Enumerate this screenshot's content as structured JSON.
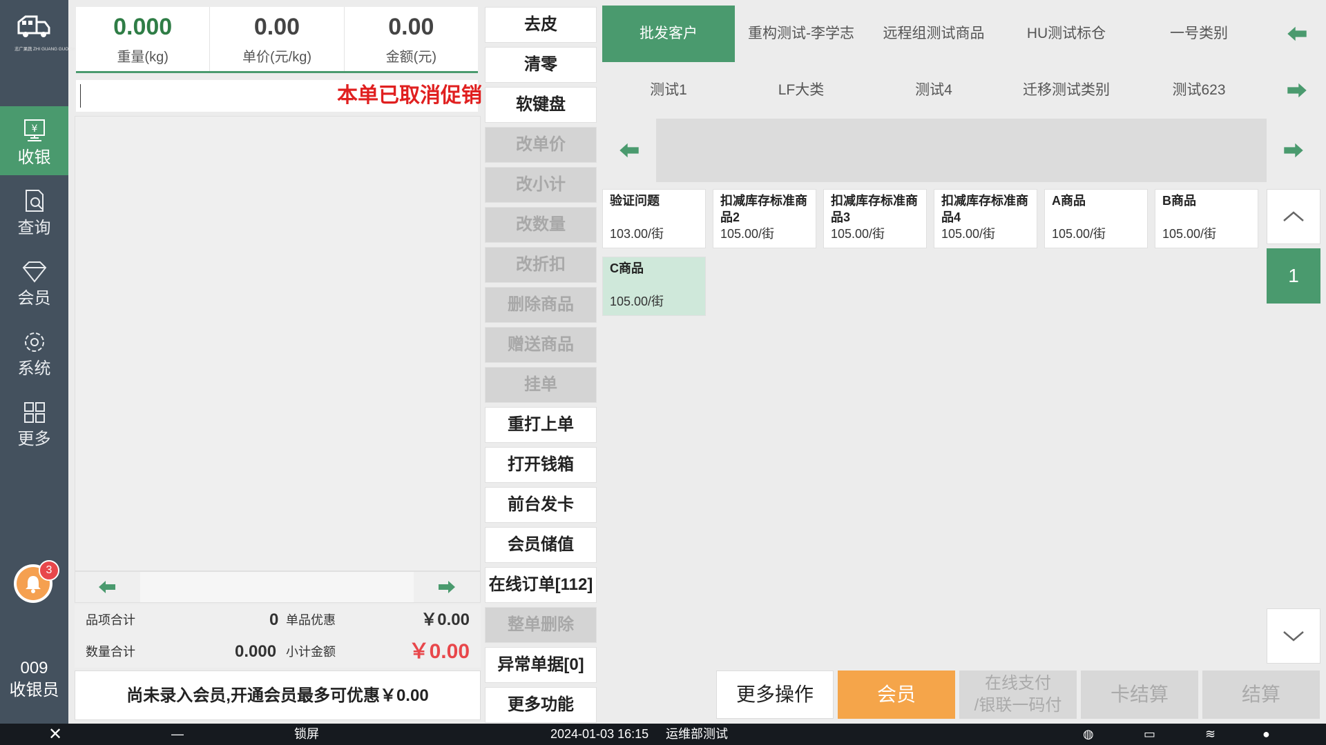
{
  "sidebar": {
    "logo_text": "志广果蔬 ZHI GUANG GUO SHU",
    "items": [
      {
        "label": "收银",
        "icon": "cashier-icon"
      },
      {
        "label": "查询",
        "icon": "search-doc-icon"
      },
      {
        "label": "会员",
        "icon": "diamond-icon"
      },
      {
        "label": "系统",
        "icon": "gear-icon"
      },
      {
        "label": "更多",
        "icon": "grid-icon"
      }
    ],
    "notification_count": "3",
    "cashier_no": "009",
    "cashier_label": "收银员"
  },
  "scale": {
    "weight": "0.000",
    "weight_label": "重量(kg)",
    "unit_price": "0.00",
    "unit_price_label": "单价(元/kg)",
    "amount": "0.00",
    "amount_label": "金额(元)"
  },
  "promo_notice": "本单已取消促销",
  "totals": {
    "items_label": "品项合计",
    "items_value": "0",
    "discount_label": "单品优惠",
    "discount_value": "￥0.00",
    "qty_label": "数量合计",
    "qty_value": "0.000",
    "subtotal_label": "小计金额",
    "subtotal_value": "￥0.00"
  },
  "member_notice": "尚未录入会员,开通会员最多可优惠￥0.00",
  "functions": [
    {
      "label": "去皮",
      "enabled": true
    },
    {
      "label": "清零",
      "enabled": true
    },
    {
      "label": "软键盘",
      "enabled": true
    },
    {
      "label": "改单价",
      "enabled": false
    },
    {
      "label": "改小计",
      "enabled": false
    },
    {
      "label": "改数量",
      "enabled": false
    },
    {
      "label": "改折扣",
      "enabled": false
    },
    {
      "label": "删除商品",
      "enabled": false
    },
    {
      "label": "赠送商品",
      "enabled": false
    },
    {
      "label": "挂单",
      "enabled": false
    },
    {
      "label": "重打上单",
      "enabled": true
    },
    {
      "label": "打开钱箱",
      "enabled": true
    },
    {
      "label": "前台发卡",
      "enabled": true
    },
    {
      "label": "会员储值",
      "enabled": true
    },
    {
      "label": "在线订单[112]",
      "enabled": true
    },
    {
      "label": "整单删除",
      "enabled": false
    },
    {
      "label": "异常单据[0]",
      "enabled": true
    },
    {
      "label": "更多功能",
      "enabled": true
    }
  ],
  "categories_row1": [
    "批发客户",
    "重构测试-李学志",
    "远程组测试商品",
    "HU测试标仓",
    "一号类别"
  ],
  "categories_row2": [
    "测试1",
    "LF大类",
    "测试4",
    "迁移测试类别",
    "测试623"
  ],
  "products": [
    {
      "name": "验证问题",
      "price": "103.00/街"
    },
    {
      "name": "扣减库存标准商品2",
      "price": "105.00/街"
    },
    {
      "name": "扣减库存标准商品3",
      "price": "105.00/街"
    },
    {
      "name": "扣减库存标准商品4",
      "price": "105.00/街"
    },
    {
      "name": "A商品",
      "price": "105.00/街"
    },
    {
      "name": "B商品",
      "price": "105.00/街"
    },
    {
      "name": "C商品",
      "price": "105.00/街"
    }
  ],
  "page_number": "1",
  "actions": {
    "more_ops": "更多操作",
    "member": "会员",
    "online_pay_1": "在线支付",
    "online_pay_2": "/银联一码付",
    "card_settle": "卡结算",
    "settle": "结算"
  },
  "taskbar": {
    "lock": "锁屏",
    "datetime": "2024-01-03 16:15",
    "store": "运维部测试"
  },
  "colors": {
    "accent_green": "#4a9a6e",
    "sidebar_bg": "#44515e",
    "alert_red": "#e02020",
    "member_orange": "#f5a54a"
  }
}
